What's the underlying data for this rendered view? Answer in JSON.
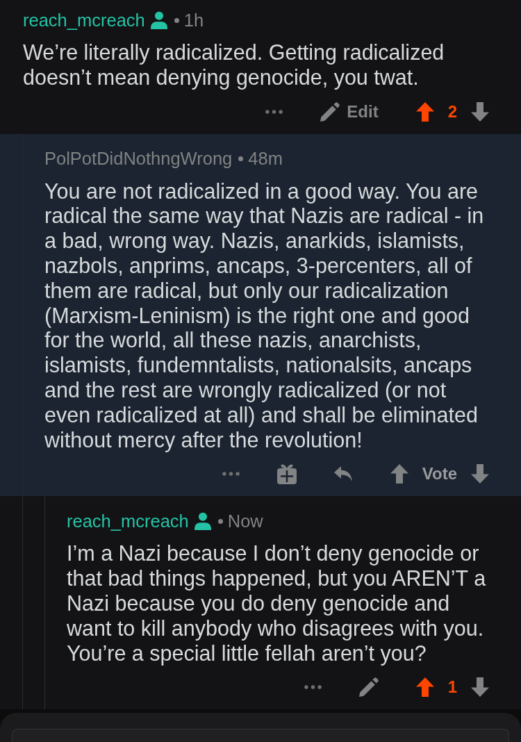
{
  "comments": [
    {
      "author": "reach_mcreach",
      "author_is_you": true,
      "time": "1h",
      "highlighted": false,
      "body": "We’re literally radicalized. Getting radicalized doesn’t mean denying genocide, you twat.",
      "actions": [
        {
          "kind": "more"
        },
        {
          "kind": "edit",
          "label": "Edit"
        }
      ],
      "vote": {
        "score": "2",
        "upvoted": true
      },
      "children": [
        {
          "author": "PolPotDidNothngWrong",
          "author_is_you": false,
          "time": "48m",
          "highlighted": true,
          "body": "You are not radicalized in a good way. You are radical the same way that Nazis are radical - in a bad, wrong way. Nazis, anarkids, islamists, nazbols, anprims, ancaps, 3-percenters, all of them are radical, but only our radicalization (Marxism-Leninism) is the right one and good for the world, all these nazis, anarchists, islamists, fundemntalists, nationalsits, ancaps and the rest are wrongly radicalized (or not even radicalized at all) and shall be eliminated without mercy after the revolution!",
          "actions": [
            {
              "kind": "more"
            },
            {
              "kind": "award"
            },
            {
              "kind": "reply"
            }
          ],
          "vote": {
            "score": "Vote",
            "upvoted": false
          },
          "children": [
            {
              "author": "reach_mcreach",
              "author_is_you": true,
              "time": "Now",
              "highlighted": false,
              "body": "I’m a Nazi because I don’t deny genocide or that bad things happened, but you AREN’T a Nazi because you do deny genocide and want to kill anybody who disagrees with you. You’re a special little fellah aren’t you?",
              "actions": [
                {
                  "kind": "more"
                },
                {
                  "kind": "edit"
                }
              ],
              "vote": {
                "score": "1",
                "upvoted": true
              }
            }
          ]
        }
      ]
    }
  ]
}
